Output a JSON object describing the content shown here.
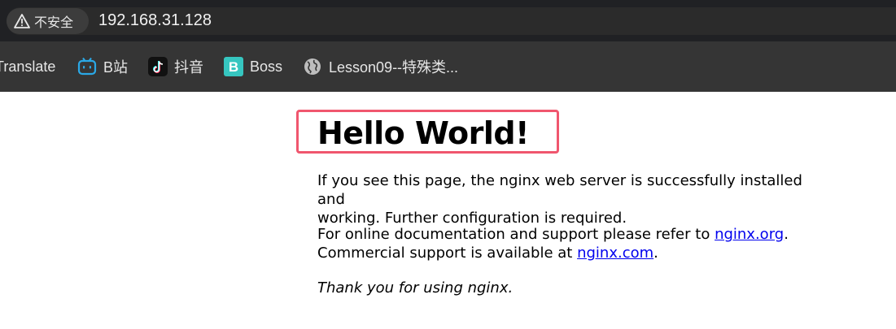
{
  "browser": {
    "security_label": "不安全",
    "url": "192.168.31.128"
  },
  "bookmarks": [
    {
      "label": "Translate",
      "icon": "translate-icon"
    },
    {
      "label": "B站",
      "icon": "bilibili-icon"
    },
    {
      "label": "抖音",
      "icon": "douyin-icon"
    },
    {
      "label": "Boss",
      "icon": "boss-icon"
    },
    {
      "label": "Lesson09--特殊类...",
      "icon": "globe-icon"
    }
  ],
  "page": {
    "title": "Hello World!",
    "p1_line1": "If you see this page, the nginx web server is successfully installed and",
    "p1_line2": "working. Further configuration is required.",
    "p2_text1": "For online documentation and support please refer to ",
    "p2_link1": "nginx.org",
    "p2_text2": ".",
    "p2_text3": "Commercial support is available at ",
    "p2_link2": "nginx.com",
    "p2_text4": ".",
    "p3": "Thank you for using nginx."
  },
  "colors": {
    "highlight": "#f0566e",
    "link": "#0000ee"
  }
}
